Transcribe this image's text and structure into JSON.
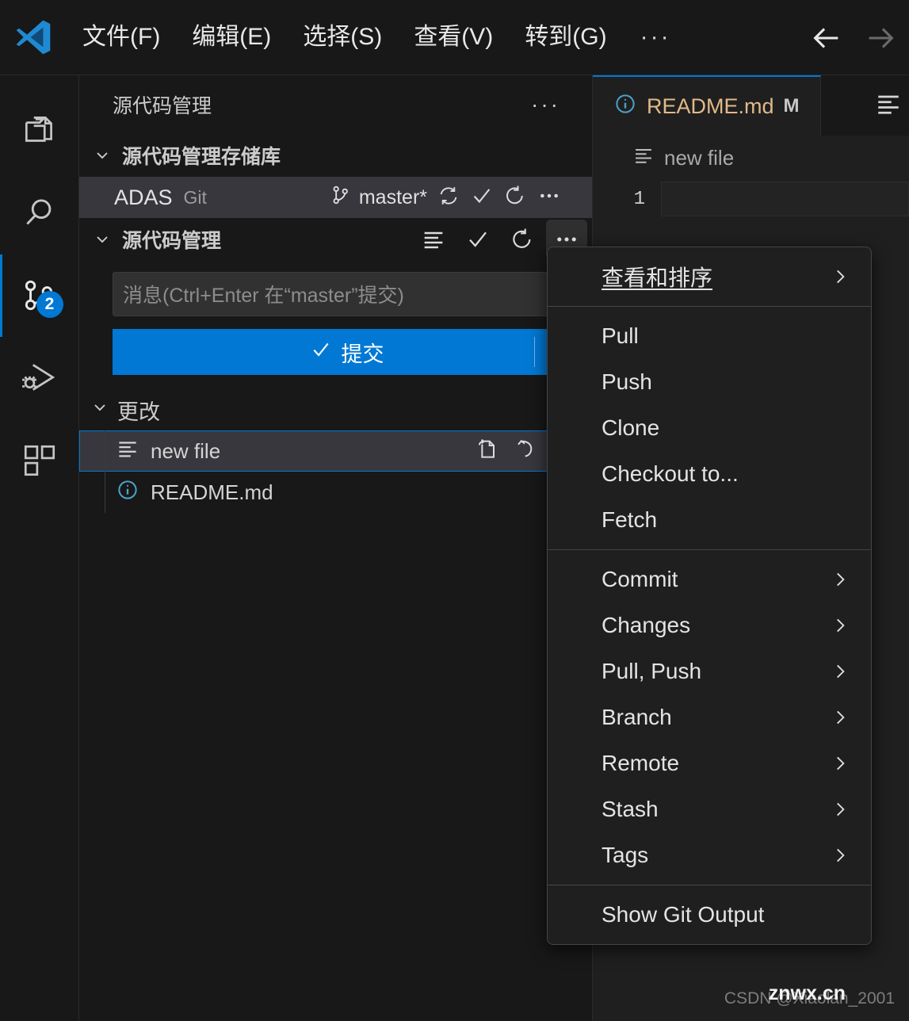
{
  "window": {
    "logo_icon": "vscode-logo-icon"
  },
  "menubar": {
    "items": [
      {
        "label": "文件(F)"
      },
      {
        "label": "编辑(E)"
      },
      {
        "label": "选择(S)"
      },
      {
        "label": "查看(V)"
      },
      {
        "label": "转到(G)"
      },
      {
        "label": "···"
      }
    ],
    "back_icon": "arrow-left-icon",
    "forward_icon": "arrow-right-icon"
  },
  "activitybar": {
    "items": [
      {
        "name": "explorer",
        "icon": "files-icon",
        "badge": ""
      },
      {
        "name": "search",
        "icon": "search-icon",
        "badge": ""
      },
      {
        "name": "source-control",
        "icon": "source-control-icon",
        "badge": "2"
      },
      {
        "name": "run-debug",
        "icon": "run-and-debug-icon",
        "badge": ""
      },
      {
        "name": "extensions",
        "icon": "extensions-icon",
        "badge": ""
      }
    ]
  },
  "sidebar": {
    "title": "源代码管理",
    "title_more": "···",
    "repositories_section": {
      "label": "源代码管理存储库",
      "chevron": "chevron-down-icon",
      "repo": {
        "name": "ADAS",
        "type": "Git",
        "branch": "master*",
        "branch_icon": "git-branch-icon",
        "sync_icon": "sync-icon",
        "check_icon": "check-icon",
        "refresh_icon": "refresh-icon",
        "more_icon": "more-icon"
      }
    },
    "scm_section": {
      "label": "源代码管理",
      "chevron": "chevron-down-icon",
      "actions": [
        {
          "icon": "view-list-icon",
          "name": "view-as-list"
        },
        {
          "icon": "check-icon",
          "name": "commit"
        },
        {
          "icon": "refresh-icon",
          "name": "refresh"
        },
        {
          "icon": "more-icon",
          "name": "more-actions"
        }
      ]
    },
    "commit_input_placeholder": "消息(Ctrl+Enter 在“master”提交)",
    "commit_button": {
      "label": "提交",
      "check_icon": "check-icon",
      "dropdown_icon": "chevron-down-icon"
    },
    "changes_group": {
      "label": "更改",
      "chevron": "chevron-down-icon",
      "count_badge": ""
    },
    "changes": [
      {
        "label": "new file",
        "icon": "list-lines-icon",
        "selected": true,
        "actions": [
          {
            "icon": "open-file-icon",
            "name": "open-file"
          },
          {
            "icon": "discard-changes-icon",
            "name": "discard-changes"
          },
          {
            "icon": "stage-changes-icon",
            "name": "stage-changes"
          }
        ]
      },
      {
        "label": "README.md",
        "icon": "info-circle-icon",
        "selected": false,
        "actions": []
      }
    ]
  },
  "editor": {
    "tab": {
      "label": "README.md",
      "modifier": "M",
      "icon": "info-circle-icon"
    },
    "tab_actions_icon": "editor-actions-icon",
    "breadcrumb": {
      "label": "new file",
      "icon": "list-lines-icon"
    },
    "lines": [
      {
        "number": "1",
        "text": ""
      }
    ]
  },
  "context_menu": {
    "groups": [
      {
        "items": [
          {
            "label": "查看和排序",
            "submenu": true,
            "underline": true
          }
        ]
      },
      {
        "items": [
          {
            "label": "Pull",
            "submenu": false,
            "underline": false
          },
          {
            "label": "Push",
            "submenu": false,
            "underline": false
          },
          {
            "label": "Clone",
            "submenu": false,
            "underline": false
          },
          {
            "label": "Checkout to...",
            "submenu": false,
            "underline": false
          },
          {
            "label": "Fetch",
            "submenu": false,
            "underline": false
          }
        ]
      },
      {
        "items": [
          {
            "label": "Commit",
            "submenu": true,
            "underline": false
          },
          {
            "label": "Changes",
            "submenu": true,
            "underline": false
          },
          {
            "label": "Pull, Push",
            "submenu": true,
            "underline": false
          },
          {
            "label": "Branch",
            "submenu": true,
            "underline": false
          },
          {
            "label": "Remote",
            "submenu": true,
            "underline": false
          },
          {
            "label": "Stash",
            "submenu": true,
            "underline": false
          },
          {
            "label": "Tags",
            "submenu": true,
            "underline": false
          }
        ]
      },
      {
        "items": [
          {
            "label": "Show Git Output",
            "submenu": false,
            "underline": false
          }
        ]
      }
    ]
  },
  "watermark": {
    "credit": "CSDN @Xiaolan_2001",
    "overlay": "znwx.cn"
  },
  "colors": {
    "accent": "#0078d4",
    "background": "#1f1f1f",
    "sidebar_bg": "#181818",
    "selection": "#37373d",
    "tab_text": "#e2b98a"
  }
}
